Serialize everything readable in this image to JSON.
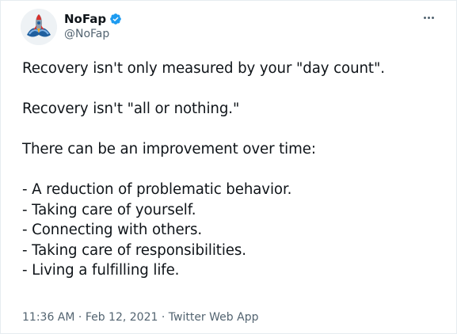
{
  "tweet": {
    "display_name": "NoFap",
    "handle": "@NoFap",
    "lines": [
      "Recovery isn't only measured by your \"day count\".",
      "",
      "Recovery isn't \"all or nothing.\"",
      "",
      "There can be an improvement over time:",
      "",
      "- A reduction of problematic behavior.",
      "- Taking care of yourself.",
      "- Connecting with others.",
      "- Taking care of responsibilities.",
      "- Living a fulfilling life."
    ],
    "time": "11:36 AM",
    "separator": " · ",
    "date": "Feb 12, 2021",
    "source": "Twitter Web App"
  },
  "icons": {
    "avatar": "nofap-rocket-logo",
    "verified": "verified-badge-icon",
    "more": "more-options-icon"
  },
  "colors": {
    "text": "#0f1419",
    "secondary": "#536471",
    "verified": "#1d9bf0",
    "border": "#e6ecf0"
  }
}
